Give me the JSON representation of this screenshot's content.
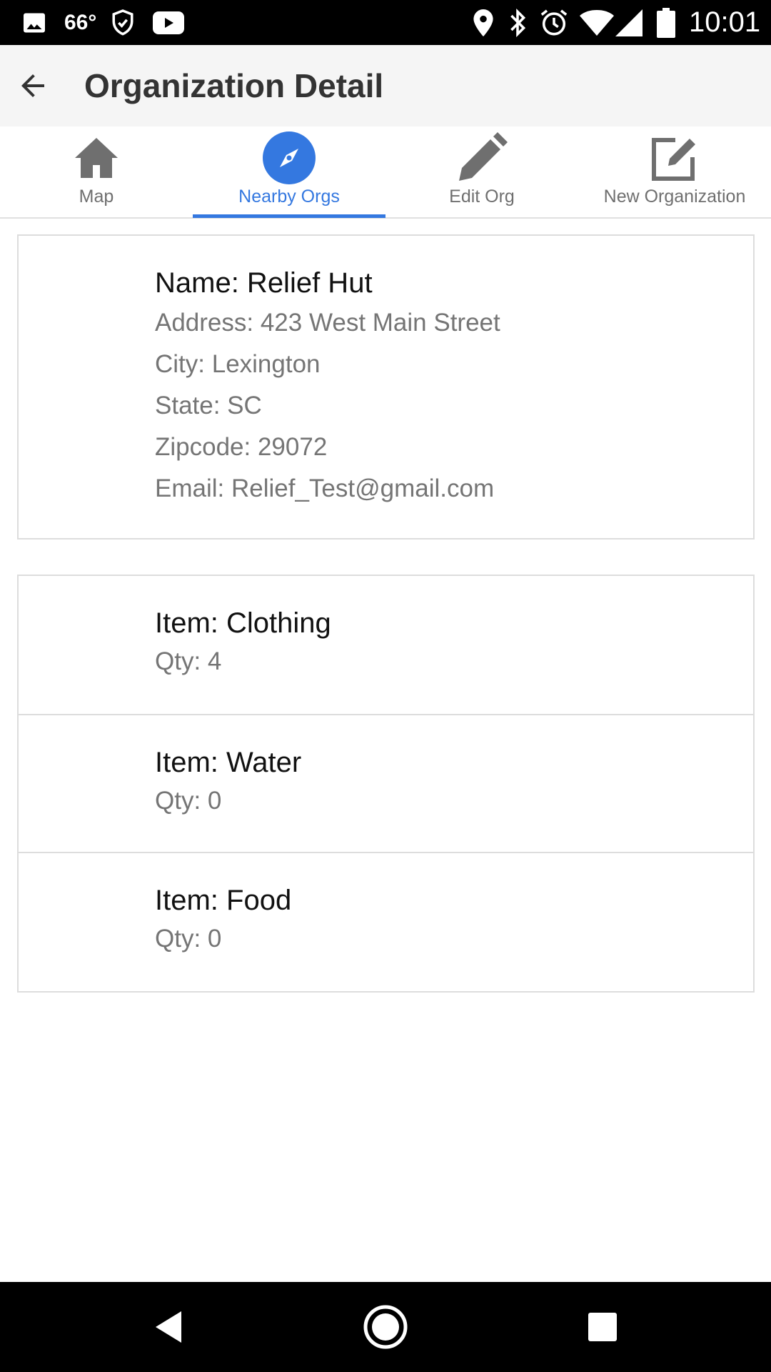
{
  "status_bar": {
    "temperature": "66°",
    "time": "10:01",
    "left_icons": [
      "image-icon",
      "shield-check-icon",
      "youtube-icon"
    ],
    "right_icons": [
      "location-pin-icon",
      "bluetooth-icon",
      "alarm-icon",
      "wifi-icon",
      "cell-signal-icon",
      "battery-icon"
    ]
  },
  "app_bar": {
    "title": "Organization Detail",
    "back_icon": "back-arrow-icon"
  },
  "tabs": [
    {
      "label": "Map",
      "icon": "home-icon",
      "active": false
    },
    {
      "label": "Nearby Orgs",
      "icon": "compass-icon",
      "active": true
    },
    {
      "label": "Edit Org",
      "icon": "pencil-icon",
      "active": false
    },
    {
      "label": "New Organization",
      "icon": "edit-square-icon",
      "active": false
    }
  ],
  "organization": {
    "name": "Name: Relief Hut",
    "address": "Address: 423 West Main Street",
    "city": "City: Lexington",
    "state": "State: SC",
    "zipcode": "Zipcode: 29072",
    "email": "Email: Relief_Test@gmail.com"
  },
  "items": [
    {
      "name": "Item: Clothing",
      "qty": "Qty: 4"
    },
    {
      "name": "Item: Water",
      "qty": "Qty: 0"
    },
    {
      "name": "Item: Food",
      "qty": "Qty: 0"
    }
  ],
  "nav_bar": {
    "icons": [
      "nav-back-icon",
      "nav-home-icon",
      "nav-recents-icon"
    ]
  },
  "colors": {
    "accent": "#3478e0",
    "icon_gray": "#6f6f6f",
    "app_bar_bg": "#f5f5f5",
    "border": "#dddddd"
  }
}
